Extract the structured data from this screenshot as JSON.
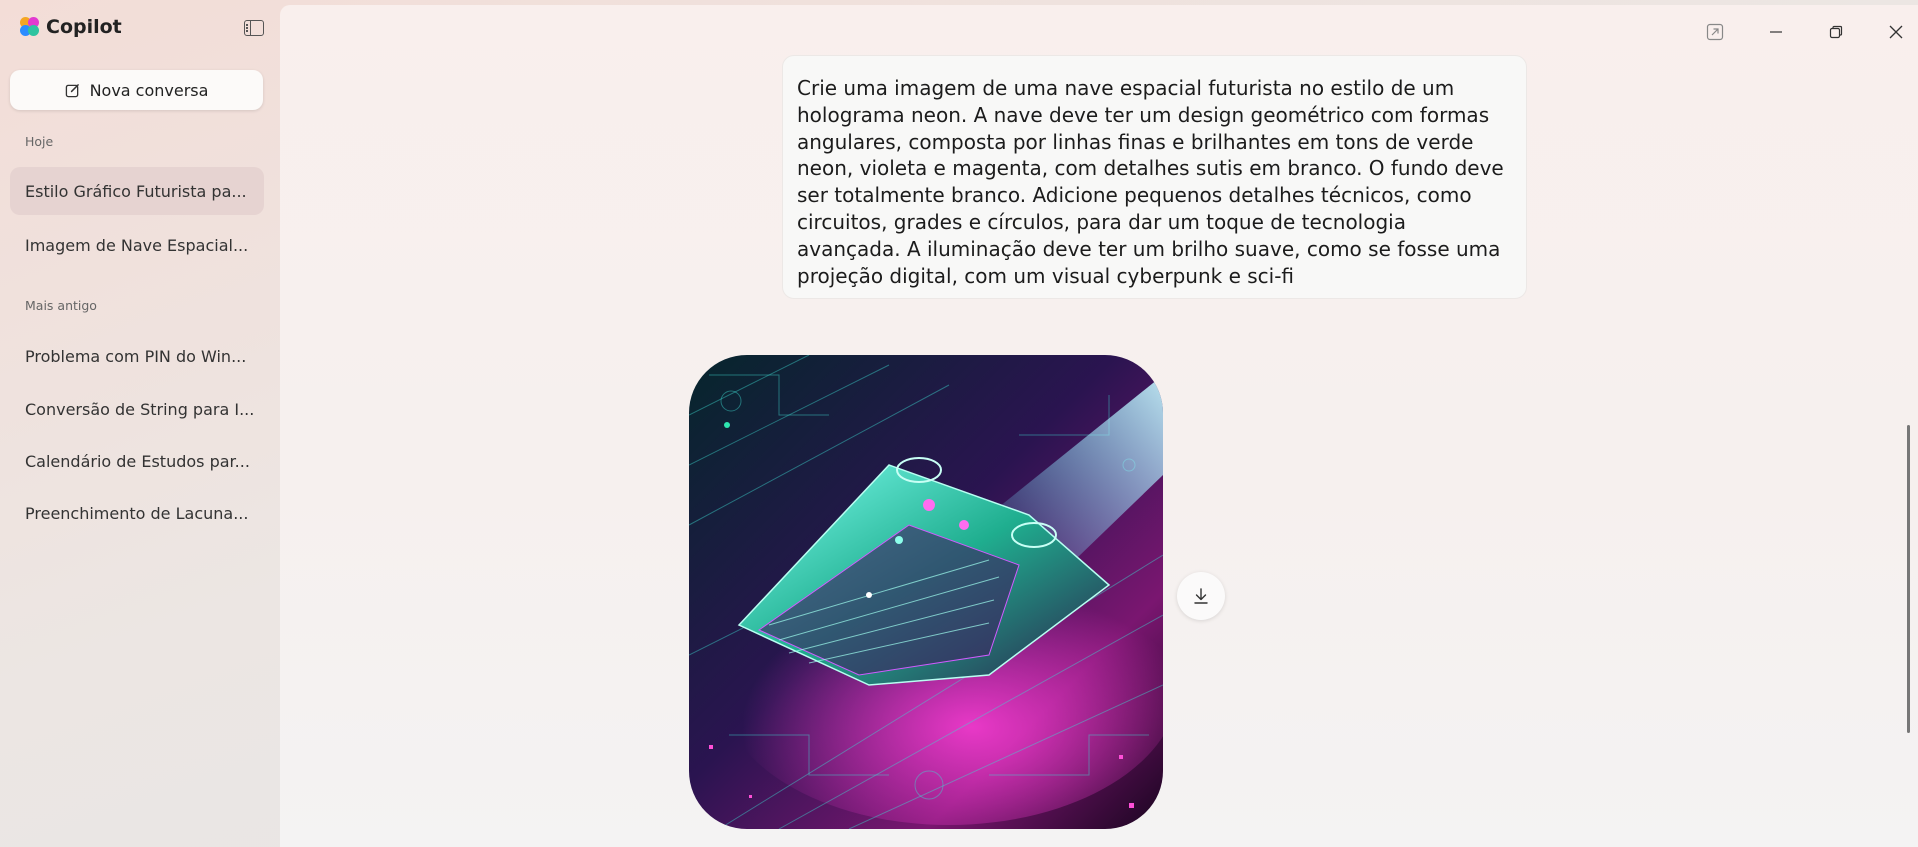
{
  "app": {
    "name": "Copilot"
  },
  "sidebar": {
    "new_chat_label": "Nova conversa",
    "sections": [
      {
        "label": "Hoje",
        "items": [
          {
            "label": "Estilo Gráfico Futurista pa...",
            "active": true
          },
          {
            "label": "Imagem de Nave Espacial...",
            "active": false
          }
        ]
      },
      {
        "label": "Mais antigo",
        "items": [
          {
            "label": "Problema com PIN do Win...",
            "active": false
          },
          {
            "label": "Conversão de String para I...",
            "active": false
          },
          {
            "label": "Calendário de Estudos par...",
            "active": false
          },
          {
            "label": "Preenchimento de Lacuna...",
            "active": false
          }
        ]
      }
    ]
  },
  "window_controls": [
    "open-in-new-window-icon",
    "minimize-icon",
    "restore-icon",
    "close-icon"
  ],
  "chat": {
    "user_message": "Crie uma imagem de uma nave espacial futurista no estilo de um holograma neon. A nave deve ter um design geométrico com formas angulares, composta por linhas finas e brilhantes em tons de verde neon, violeta e  magenta, com detalhes sutis em branco. O fundo deve ser totalmente branco. Adicione pequenos detalhes técnicos, como circuitos, grades e círculos, para dar um toque de tecnologia avançada. A iluminação deve ter um brilho suave, como se fosse uma projeção digital, com um visual cyberpunk e sci-fi",
    "image_icon": "download-icon"
  },
  "colors": {
    "accent_green": "#2ee6b0",
    "accent_magenta": "#e23ad0",
    "accent_violet": "#7b3cff"
  }
}
